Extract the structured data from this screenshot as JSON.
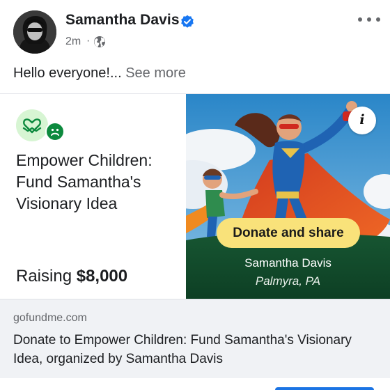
{
  "post": {
    "author": "Samantha Davis",
    "time": "2m",
    "separator": "·",
    "text": "Hello everyone!...",
    "see_more": "See more"
  },
  "icons": {
    "verified": "verified-badge-icon",
    "audience": "globe-icon",
    "more": "more-options-icon",
    "info": "info-icon",
    "logo": "heart-hands-icon",
    "badge": "sad-face-icon"
  },
  "fundraiser": {
    "title": "Empower Children: Fund Samantha's Visionary Idea",
    "raising_label": "Raising",
    "goal": "$8,000",
    "info_label": "i",
    "donate_label": "Donate and share",
    "organizer": "Samantha Davis",
    "location": "Palmyra, PA"
  },
  "link": {
    "domain": "gofundme.com",
    "title": "Donate to Empower Children: Fund Samantha's Visionary Idea, organized by Samantha Davis"
  },
  "colors": {
    "verified_blue": "#1877f2",
    "donate_yellow": "#f9e27a",
    "gofundme_green": "#0d8a3e",
    "card_green": "#0d4a2c"
  }
}
